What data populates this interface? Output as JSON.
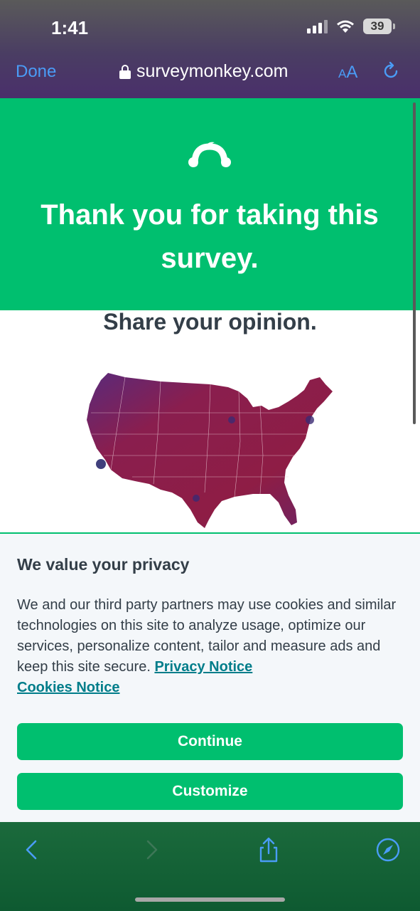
{
  "status_bar": {
    "time": "1:41",
    "battery": "39"
  },
  "browser": {
    "done_label": "Done",
    "url": "surveymonkey.com",
    "aa_small": "A",
    "aa_big": "A"
  },
  "header": {
    "title": "Thank you for taking this survey."
  },
  "content": {
    "share_title": "Share your opinion."
  },
  "privacy": {
    "title": "We value your privacy",
    "body": "We and our third party partners may use cookies and similar technologies on this site to analyze usage, optimize our services, personalize content, tailor and measure ads and keep this site secure.",
    "privacy_link": "Privacy Notice",
    "cookies_link": "Cookies Notice",
    "continue_label": "Continue",
    "customize_label": "Customize"
  },
  "colors": {
    "brand_green": "#00bf6f",
    "link_teal": "#007d8a",
    "ios_blue": "#4a9cf6"
  }
}
